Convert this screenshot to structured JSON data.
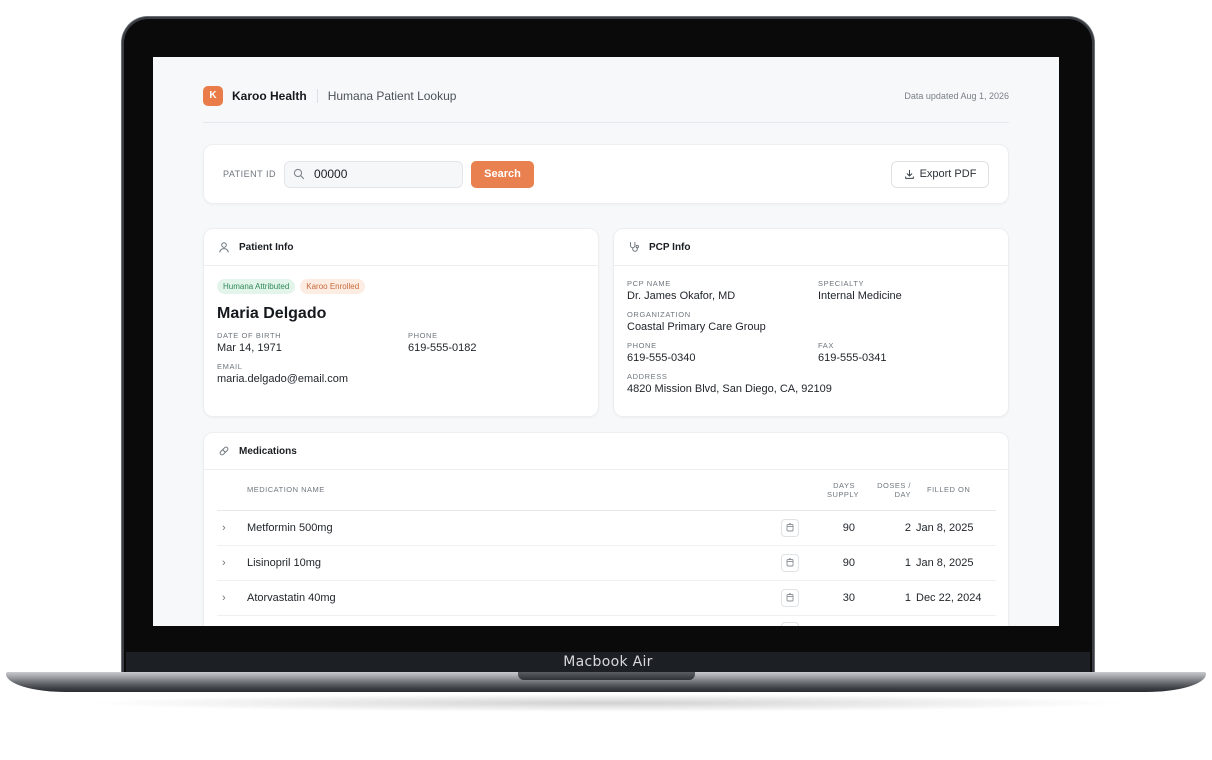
{
  "device": {
    "label": "Macbook Air"
  },
  "header": {
    "logo_letter": "K",
    "brand": "Karoo Health",
    "title": "Humana Patient Lookup",
    "updated": "Data updated Aug 1, 2026"
  },
  "search": {
    "label": "PATIENT ID",
    "value": "00000",
    "button": "Search",
    "export": "Export PDF"
  },
  "patient": {
    "section_title": "Patient Info",
    "badges": [
      "Humana Attributed",
      "Karoo Enrolled"
    ],
    "name": "Maria Delgado",
    "dob_label": "DATE OF BIRTH",
    "dob": "Mar 14, 1971",
    "phone_label": "PHONE",
    "phone": "619-555-0182",
    "email_label": "EMAIL",
    "email": "maria.delgado@email.com"
  },
  "pcp": {
    "section_title": "PCP Info",
    "name_label": "PCP NAME",
    "name": "Dr. James Okafor, MD",
    "specialty_label": "SPECIALTY",
    "specialty": "Internal Medicine",
    "org_label": "ORGANIZATION",
    "org": "Coastal Primary Care Group",
    "phone_label": "PHONE",
    "phone": "619-555-0340",
    "fax_label": "FAX",
    "fax": "619-555-0341",
    "address_label": "ADDRESS",
    "address": "4820 Mission Blvd, San Diego, CA, 92109"
  },
  "medications": {
    "section_title": "Medications",
    "columns": {
      "name": "MEDICATION NAME",
      "days_supply": "DAYS SUPPLY",
      "doses_per_day": "DOSES / DAY",
      "filled_on": "FILLED ON"
    },
    "rows": [
      {
        "name": "Metformin 500mg",
        "days_supply": "90",
        "doses_per_day": "2",
        "filled_on": "Jan 8, 2025"
      },
      {
        "name": "Lisinopril 10mg",
        "days_supply": "90",
        "doses_per_day": "1",
        "filled_on": "Jan 8, 2025"
      },
      {
        "name": "Atorvastatin 40mg",
        "days_supply": "30",
        "doses_per_day": "1",
        "filled_on": "Dec 22, 2024"
      },
      {
        "name": "",
        "days_supply": "",
        "doses_per_day": "",
        "filled_on": ""
      }
    ]
  },
  "colors": {
    "accent": "#e9804f",
    "badge_green_bg": "#e3f5eb",
    "badge_orange_bg": "#fdece2"
  },
  "icons": [
    "search-icon",
    "download-icon",
    "user-icon",
    "stethoscope-icon",
    "pill-icon",
    "chevron-right-icon",
    "pill-detail-icon"
  ]
}
